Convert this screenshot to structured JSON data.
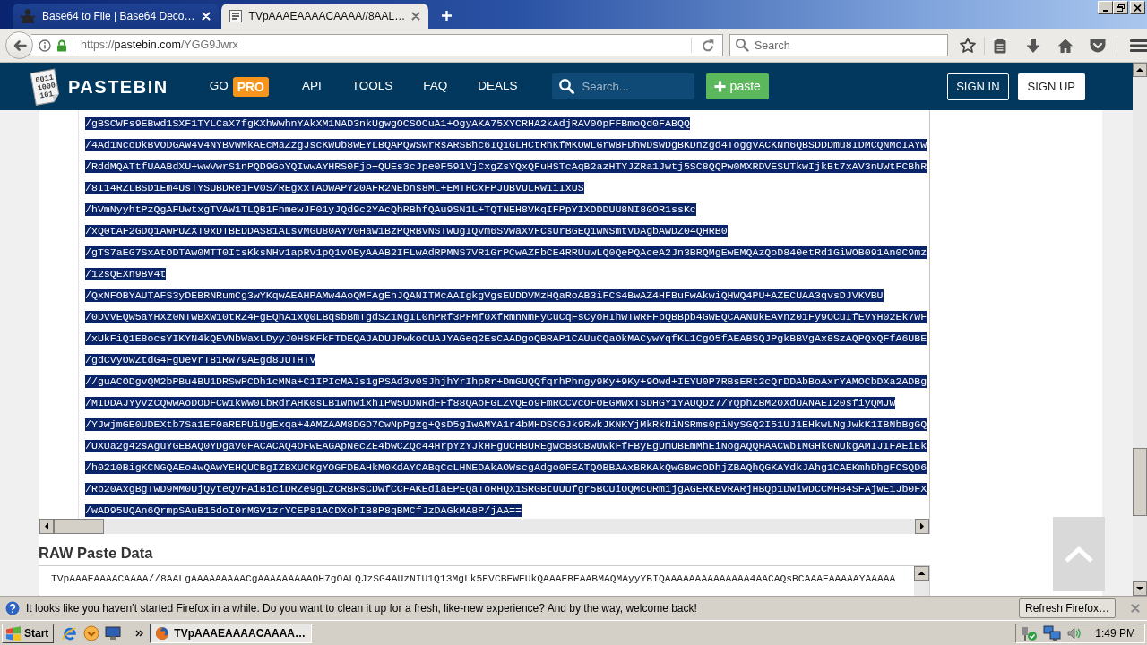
{
  "browser": {
    "tabs": [
      {
        "title": "Base64 to File | Base64 Deco…",
        "selected": false
      },
      {
        "title": "TVpAAAEAAAACAAAA//8AAL…",
        "selected": true
      }
    ],
    "address": {
      "scheme": "https://",
      "host": "pastebin.com",
      "path": "/YGG9Jwrx"
    },
    "search": {
      "placeholder": "Search"
    }
  },
  "site_header": {
    "logo": {
      "digits": [
        "0011",
        "1000",
        "101"
      ],
      "title": "PASTEBIN"
    },
    "go_pro": {
      "label": "GO",
      "badge": "PRO"
    },
    "nav": [
      "API",
      "TOOLS",
      "FAQ",
      "DEALS"
    ],
    "search": {
      "placeholder": "Search..."
    },
    "new_paste": "paste",
    "sign_in": "SIGN IN",
    "sign_up": "SIGN UP"
  },
  "code": {
    "selected": true,
    "lines": [
      "/gBSCWFs9EBwd1SXF1TYLCaX7fgKXhWwhnYAkXM1NAD3nkUgwgOCSOCuA1+OgyAKA75XYCRHA2kAdjRAV0OpFFBmoQd0FABQQ",
      "/4Ad1NcoDkBVODGAW4v4NYBVWMkAEcMaZzgJscKWUb8wEYLBQAPQWSwrRsARSBhc6IQ1GLHCtRhKfMKOWLGrWBFDhwDswDgBKDnzgd4ToggVACKNn6QBSDDDmu8IDMCQNMcIAYw",
      "/RddMQATtfUAABdXU+wwVwrS1nPQD9GoYQIwwAYHRS0Fjo+QUEs3cJpe0F591VjCxgZsYQxQFuHSTcAqB2azHTYJZRa1Jwtj5SC8QQPw0MXRDVESUTkwIjkBt7xAV3nUWtFCBhR",
      "/8I14RZLBSD1Em4UsTYSUBDRe1Fv0S/REgxxTAOwAPY20AFR2NEbns8ML+EMTHCxFPJUBVULRw1iIxUS",
      "/hVmNyyhtPzQgAFUwtxgTVAW1TLQB1FnmewJF01yJQd9c2YAcQhRBhfQAu9SN1L+TQTNEH8VKqIFPpYIXDDDUU8NI80OR1ssKc",
      "/xQ0tAF2GDQ1AWPUZXT9xDTBEDDAS81ALsVMGU80AYv0Haw1BzPQRBVNSTwUgIQVm6SVwaXVFCsUrBGEQ1wNSmtVDAgbAwDZ04QHRB0",
      "/gTS7aEG7SxAtODTAw0MTT0ItsKksNHv1apRV1pQ1vOEyAAAB2IFLwAdRPMNS7VR1GrPCwAZFbCE4RRUuwLQ0QePQAceA2Jn3BRQMgEwEMQAzQoD840etRd1GiWOB091An0C9mz",
      "/12sQEXn9BV4t",
      "/QxNFOBYAUTAFS3yDEBRNRumCg3wYKqwAEAHPAMw4AoQMFAgEhJQANITMcAAIgkgVgsEUDDVMzHQaRoAB3iFCS4BwAZ4HFBuFwAkwiQHWQ4PU+AZECUAA3qvsDJVKVBU",
      "/0DVVEQw5aYHXz0NTwBXW10tRZ4FgEQhA1xQ0LBqsbBmTgdSZ1NgIL0nPRf3PFMf0XfRmnNmFyCuCqFsCyoHIhwTwRFFpQBBpb4GwEQCAANUkEAVnz01Fy9OCuIfEVYH02Ek7wF",
      "/xUkFiQ1E8ocsYIKYN4kQEVNbWaxLDyyJ0HSKFkFTDEQAJADUJPwkoCUAJYAGeq2EsCAADgoQBRAP1CAUuCQaOkMACywYqfKL1CgO5fAEABSQJPgkBBVgAx8SzAQPQxQFfA6UBE",
      "/gdCVyOwZtdG4FgUevrT81RW79AEgd8JUTHTV",
      "//guACODgvQM2bPBu4BU1DRSwPCDh1cMNa+C1IPIcMAJs1gPSAd3v0SJhjhYrIhpRr+DmGUQQfqrhPhngy9Ky+9Ky+9Owd+IEYU0P7RBsERt2cQrDDAbBoAxrYAMOCbDXa2ADBg",
      "/MIDDAJYyvzCQwwAoDODFCw1kWw0LbRdrAHK0sLB1WnwixhIPW5UDNRdFFf88QAoFGLZVQEo9FmRCCvcOFOEGMWxTSDHGY1YAUQDz7/YQphZBM20XdUANAEI20sfiyQMJW",
      "/YJwjmGE0UDEXtb7Sa1EF0aREPUiUgExqa+4AMZAAM8DGD7CwNpPgzg+QsD5gIwAMYA1r4bMHDSCGJk9RwkJKNKYjMkRkNiNSRms0piNySGQ2I51UJ1EHkwLNgJwkK1IBNbBgGQ",
      "/UXUa2g42sAguYGEBAQ0YDgaV0FACACAQ4OFwEAGApNecZE4bwCZQc44HrpYzYJkHFgUCHBUREgwcBBCBwUwkFfFByEgUmUBEmMhEiNogAQQHAACWbIMGHkGNUkgAMIJIFAEiEk",
      "/h0210BigKCNGQAEo4wQAwYEHQUCBgIZBXUCKgYOGFDBAHkM0KdAYCABqCcLHNEDAkAOWscgAdgo0FEATQOBBAAxBRKAkQwGBwcODhjZBAQhQGKAYdkJAhg1CAEKmhDhgFCSQD6",
      "/Rb20AxgBgTwD9MM0UjQyteQVHAiBiciDRZe9gLzCRBRsCDwfCCFAKEdiaEPEQaToRHQX1SRGBtUUUfgr5BCUiOQMcURmijgAGERKBvRARjHBQp1DWiwDCCMHB4SFAjWE1Jb0FX",
      "/wAD95UQAn6QrmpSAuB15doI0rMGV1zrYCEP81ACDXohIB8P8qBMCfJzDAGkMA8P/jAA=="
    ]
  },
  "raw_paste": {
    "heading": "RAW Paste Data",
    "text": "TVpAAAEAAAACAAAA//8AALgAAAAAAAAACgAAAAAAAAAOH7gOALQJzSG4AUzNIU1Q13MgLk5EVCBEWEUkQAAAEBEAABMAQMAyyYBIQAAAAAAAAAAAAAA4AACAQsBCAAAEAAAAAYAAAAA"
  },
  "notification": {
    "message": "It looks like you haven’t started Firefox in a while. Do you want to clean it up for a fresh, like-new experience? And by the way, welcome back!",
    "button": "Refresh Firefox…"
  },
  "taskbar": {
    "start": "Start",
    "tasks": [
      {
        "title": "TVpAAAEAAAACAAAA…",
        "selected": true
      }
    ],
    "clock": "1:49 PM"
  }
}
